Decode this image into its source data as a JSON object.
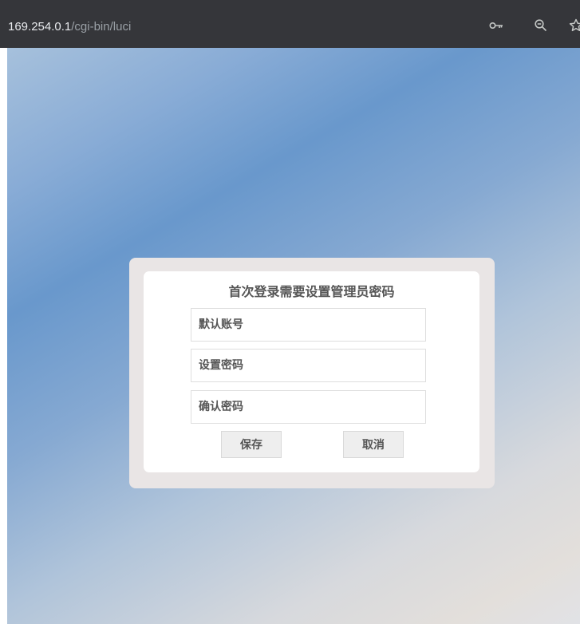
{
  "browser": {
    "url_host": "169.254.0.1",
    "url_path": "/cgi-bin/luci",
    "icons": [
      "key-icon",
      "zoom-icon",
      "bookmark-star-icon"
    ]
  },
  "dialog": {
    "title": "首次登录需要设置管理员密码",
    "account_placeholder": "默认账号",
    "password_placeholder": "设置密码",
    "confirm_placeholder": "确认密码",
    "save_label": "保存",
    "cancel_label": "取消"
  },
  "colors": {
    "toolbar": "#35363a",
    "dialog_frame": "#e9e5e5",
    "text": "#555555",
    "button_bg": "#eeeeee",
    "background_blue": "#6998cc",
    "background_grey": "#e1e2e6"
  }
}
